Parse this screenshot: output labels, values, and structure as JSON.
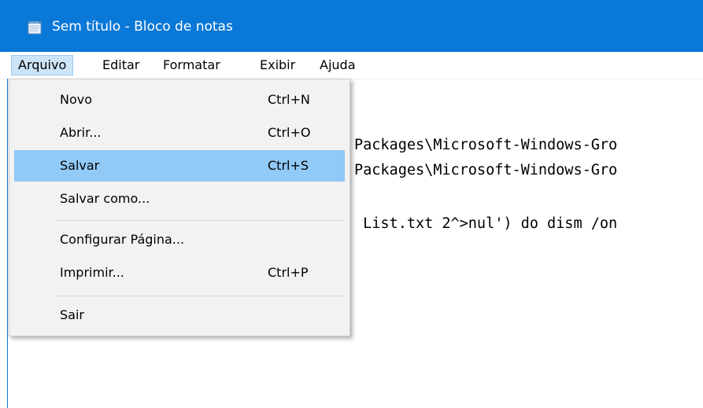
{
  "window": {
    "title": "Sem título - Bloco de notas",
    "icon": "notepad-icon"
  },
  "menubar": {
    "items": [
      {
        "label": "Arquivo",
        "active": true
      },
      {
        "label": "Editar"
      },
      {
        "label": "Formatar"
      },
      {
        "label": "Exibir"
      },
      {
        "label": "Ajuda"
      }
    ]
  },
  "file_menu": {
    "items": [
      {
        "label": "Novo",
        "shortcut": "Ctrl+N"
      },
      {
        "label": "Abrir...",
        "shortcut": "Ctrl+O"
      },
      {
        "label": "Salvar",
        "shortcut": "Ctrl+S",
        "highlighted": true
      },
      {
        "label": "Salvar como...",
        "shortcut": ""
      },
      {
        "label": "Configurar Página...",
        "shortcut": ""
      },
      {
        "label": "Imprimir...",
        "shortcut": "Ctrl+P"
      },
      {
        "label": "Sair",
        "shortcut": ""
      }
    ]
  },
  "editor": {
    "lines": [
      "Packages\\Microsoft-Windows-Gro",
      "Packages\\Microsoft-Windows-Gro",
      " List.txt 2^>nul') do dism /on"
    ]
  },
  "colors": {
    "titlebar": "#0a78d7",
    "menu_highlight": "#91c9f7",
    "menubar_active": "#cce4f7"
  }
}
